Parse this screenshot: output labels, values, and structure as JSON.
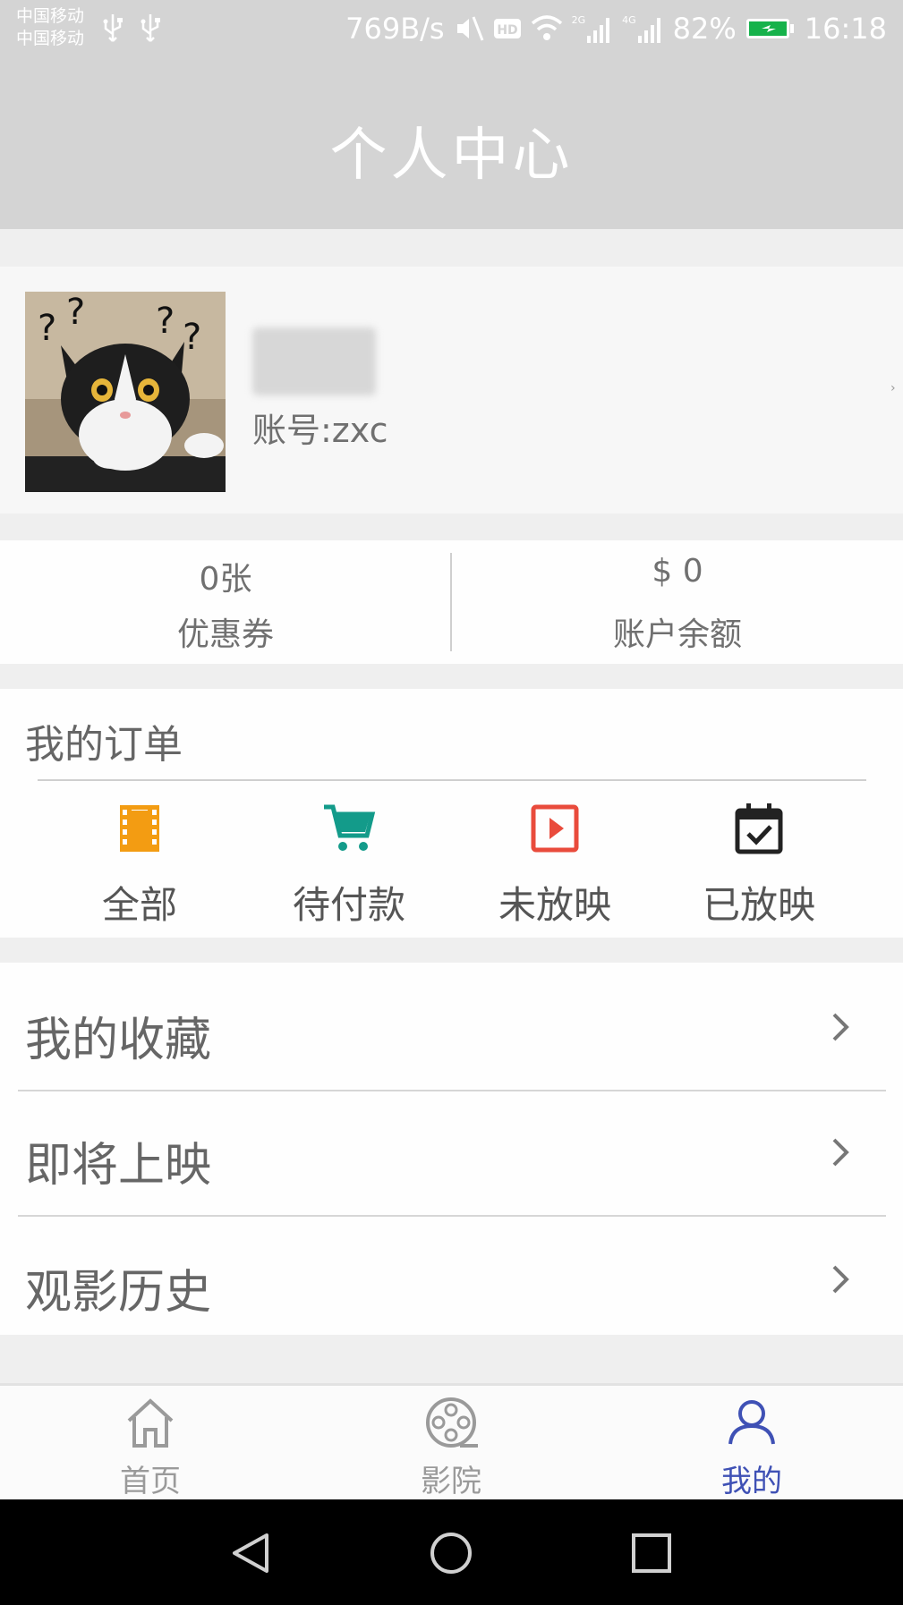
{
  "status_bar": {
    "carrier_1": "中国移动",
    "carrier_2": "中国移动",
    "speed": "769B/s",
    "network_2g": "2G",
    "network_4g": "4G",
    "battery": "82%",
    "time": "16:18",
    "icons": [
      "usb-icon",
      "usb-icon",
      "mute-icon",
      "hd-icon",
      "wifi-icon",
      "signal-icon",
      "signal-icon",
      "battery-charging-icon"
    ]
  },
  "header": {
    "title": "个人中心"
  },
  "profile": {
    "account": "账号:zxc",
    "avatar_icon": "cat-avatar-image"
  },
  "stats": [
    {
      "value": "0张",
      "label": "优惠券"
    },
    {
      "value": "$ 0",
      "label": "账户余额"
    }
  ],
  "orders": {
    "title": "我的订单",
    "items": [
      {
        "label": "全部",
        "icon": "film-icon",
        "color": "#f39c12"
      },
      {
        "label": "待付款",
        "icon": "cart-icon",
        "color": "#139b8a"
      },
      {
        "label": "未放映",
        "icon": "play-icon",
        "color": "#e94b3c"
      },
      {
        "label": "已放映",
        "icon": "calendar-check-icon",
        "color": "#222222"
      }
    ]
  },
  "menu": [
    {
      "label": "我的收藏",
      "icon": "chevron-right-icon"
    },
    {
      "label": "即将上映",
      "icon": "chevron-right-icon"
    },
    {
      "label": "观影历史",
      "icon": "chevron-right-icon"
    }
  ],
  "bottom_nav": {
    "items": [
      {
        "label": "首页",
        "icon": "home-icon",
        "active": false
      },
      {
        "label": "影院",
        "icon": "film-reel-icon",
        "active": false
      },
      {
        "label": "我的",
        "icon": "user-icon",
        "active": true
      }
    ],
    "active_color": "#3f51b5",
    "inactive_color": "#9a9a9a"
  },
  "android_nav": {
    "icons": [
      "back-icon",
      "home-circle-icon",
      "recents-icon"
    ]
  }
}
